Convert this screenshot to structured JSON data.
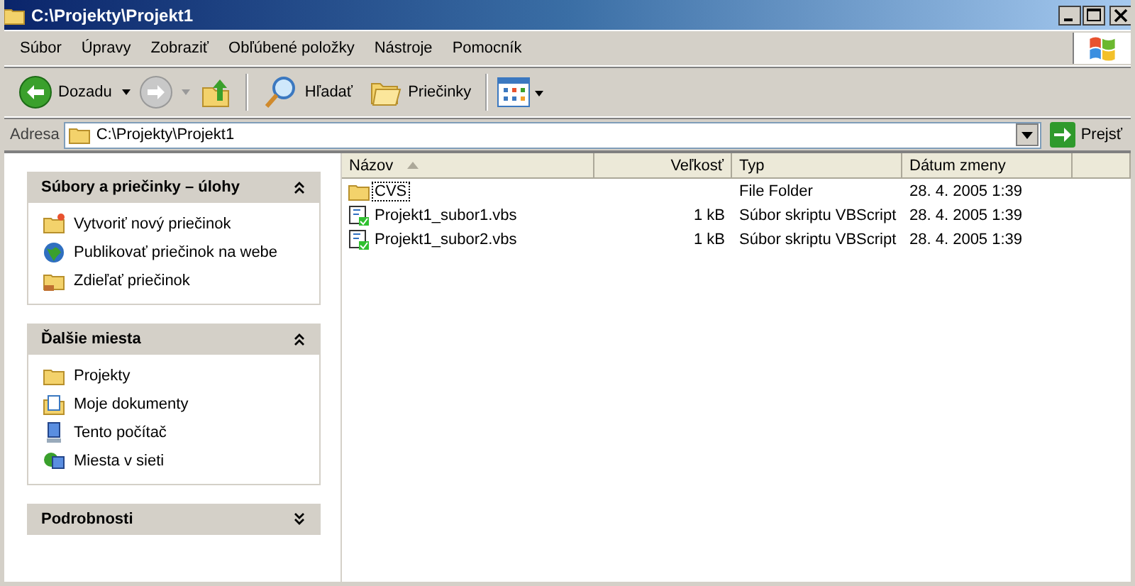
{
  "window": {
    "title": "C:\\Projekty\\Projekt1"
  },
  "menu": [
    "Súbor",
    "Úpravy",
    "Zobraziť",
    "Obľúbené položky",
    "Nástroje",
    "Pomocník"
  ],
  "toolbar": {
    "back": "Dozadu",
    "search": "Hľadať",
    "folders": "Priečinky"
  },
  "address": {
    "label": "Adresa",
    "value": "C:\\Projekty\\Projekt1",
    "go": "Prejsť"
  },
  "panes": [
    {
      "title": "Súbory a priečinky – úlohy",
      "expanded": true,
      "items": [
        "Vytvoriť nový priečinok",
        "Publikovať priečinok na webe",
        "Zdieľať priečinok"
      ]
    },
    {
      "title": "Ďalšie miesta",
      "expanded": true,
      "items": [
        "Projekty",
        "Moje dokumenty",
        "Tento počítač",
        "Miesta v sieti"
      ]
    },
    {
      "title": "Podrobnosti",
      "expanded": false
    }
  ],
  "columns": [
    "Názov",
    "Veľkosť",
    "Typ",
    "Dátum zmeny"
  ],
  "files": [
    {
      "kind": "folder",
      "name": "CVS",
      "type": "File Folder",
      "date": "28. 4. 2005 1:39",
      "focused": true
    },
    {
      "kind": "script",
      "name": "Projekt1_subor1.vbs",
      "size": "1 kB",
      "type": "Súbor skriptu VBScript",
      "date": "28. 4. 2005 1:39",
      "focused": false
    },
    {
      "kind": "script",
      "name": "Projekt1_subor2.vbs",
      "size": "1 kB",
      "type": "Súbor skriptu VBScript",
      "date": "28. 4. 2005 1:39",
      "focused": false
    }
  ]
}
